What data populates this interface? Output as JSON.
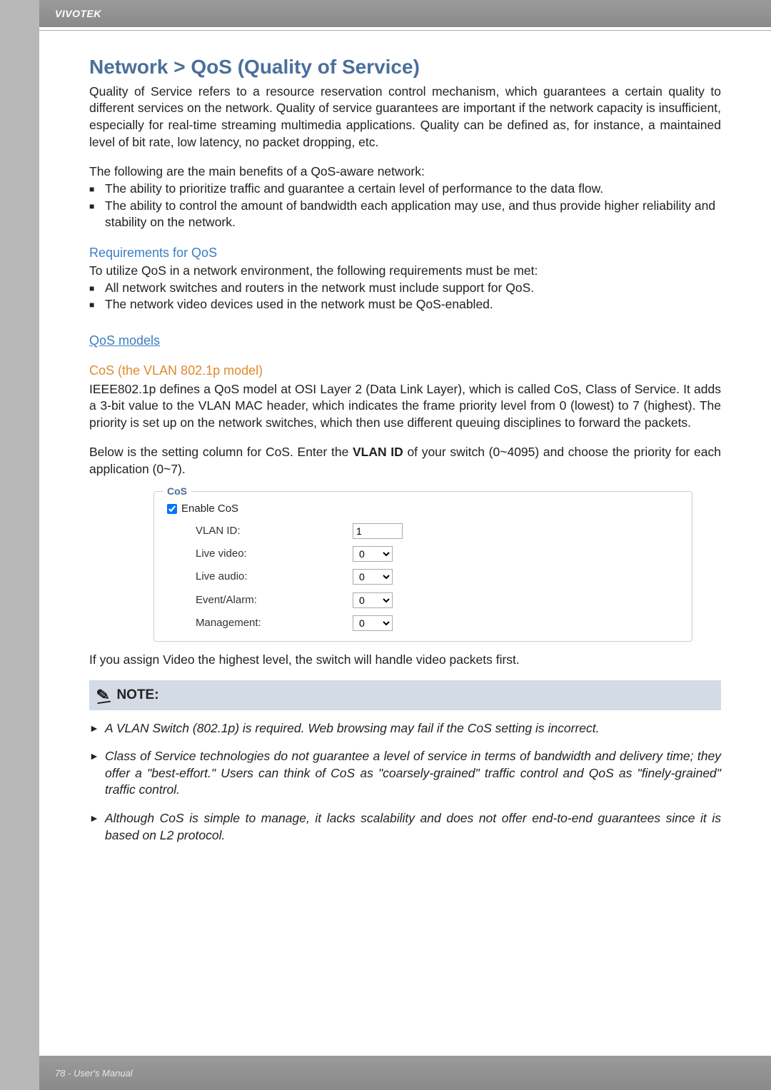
{
  "header": {
    "brand": "VIVOTEK"
  },
  "title": "Network > QoS (Quality of Service)",
  "intro": "Quality of Service refers to a resource reservation control mechanism, which guarantees a certain quality to different services on the network. Quality of service guarantees are important if the network capacity is insufficient, especially for real-time streaming multimedia applications. Quality can be defined as, for instance, a maintained level of bit rate, low latency, no packet dropping, etc.",
  "benefits_lead": "The following are the main benefits of a QoS-aware network:",
  "benefits": [
    "The ability to prioritize traffic and guarantee a certain level of performance to the data flow.",
    "The ability to control the amount of bandwidth each application may use, and thus provide higher reliability and stability on the network."
  ],
  "req_heading": "Requirements for QoS",
  "req_lead": "To utilize QoS in a network environment, the following requirements must be met:",
  "req_items": [
    "All network switches and routers in the network must include support for QoS.",
    "The network video devices used in the network must be QoS-enabled."
  ],
  "models_heading": "QoS models",
  "cos_heading": "CoS (the VLAN 802.1p model)",
  "cos_para": "IEEE802.1p defines a QoS model at OSI Layer 2 (Data Link Layer), which is called CoS, Class of Service. It adds a 3-bit value to the VLAN MAC header, which indicates the frame priority level from 0 (lowest) to 7 (highest). The priority is set up on the network switches, which then use different queuing disciplines to forward the packets.",
  "cos_below_pre": "Below is the setting column for CoS. Enter the ",
  "cos_below_bold": "VLAN ID",
  "cos_below_post": " of your switch (0~4095) and choose the priority for each application (0~7).",
  "cos_box": {
    "legend": "CoS",
    "enable_label": "Enable CoS",
    "vlan_label": "VLAN ID:",
    "vlan_value": "1",
    "rows": [
      {
        "label": "Live video:",
        "value": "0"
      },
      {
        "label": "Live audio:",
        "value": "0"
      },
      {
        "label": "Event/Alarm:",
        "value": "0"
      },
      {
        "label": "Management:",
        "value": "0"
      }
    ]
  },
  "after_box": "If you assign Video the highest level, the switch will handle video packets first.",
  "note_label": "NOTE:",
  "notes": [
    "A VLAN Switch (802.1p) is required. Web browsing may fail if the CoS setting is incorrect.",
    "Class of Service technologies do not guarantee a level of service in terms of bandwidth and delivery time; they offer a \"best-effort.\" Users can think of CoS as \"coarsely-grained\" traffic control and QoS as \"finely-grained\" traffic control.",
    "Although CoS is simple to manage, it lacks scalability and does not offer end-to-end guarantees since it is based on L2 protocol."
  ],
  "footer": "78 - User's Manual"
}
